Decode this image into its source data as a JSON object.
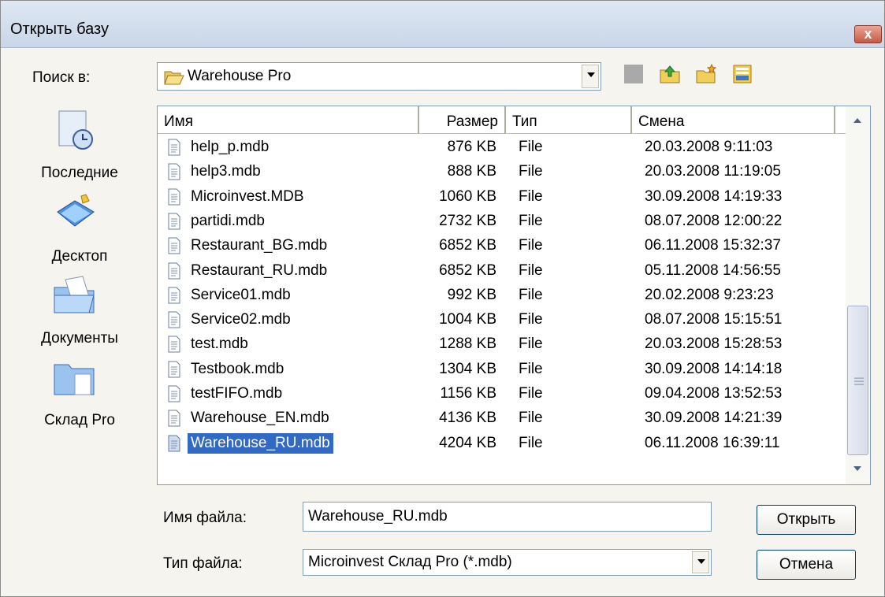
{
  "window": {
    "title": "Открыть базу",
    "close_label": "x"
  },
  "look_in": {
    "label": "Поиск в:",
    "value": "Warehouse Pro"
  },
  "toolbar": {
    "icons": [
      "back-icon",
      "up-folder-icon",
      "new-folder-icon",
      "view-menu-icon"
    ]
  },
  "places": [
    {
      "label": "Последние",
      "icon": "recent-icon"
    },
    {
      "label": "Десктоп",
      "icon": "desktop-icon"
    },
    {
      "label": "Документы",
      "icon": "documents-icon"
    },
    {
      "label": "Склад Pro",
      "icon": "folder-icon"
    }
  ],
  "columns": {
    "name": "Имя",
    "size": "Размер",
    "type": "Тип",
    "modified": "Смена"
  },
  "files": [
    {
      "name": "help_p.mdb",
      "size": "876 KB",
      "type": "File",
      "date": "20.03.2008 9:11:03"
    },
    {
      "name": "help3.mdb",
      "size": "888 KB",
      "type": "File",
      "date": "20.03.2008 11:19:05"
    },
    {
      "name": "Microinvest.MDB",
      "size": "1060 KB",
      "type": "File",
      "date": "30.09.2008 14:19:33"
    },
    {
      "name": "partidi.mdb",
      "size": "2732 KB",
      "type": "File",
      "date": "08.07.2008 12:00:22"
    },
    {
      "name": "Restaurant_BG.mdb",
      "size": "6852 KB",
      "type": "File",
      "date": "06.11.2008 15:32:37"
    },
    {
      "name": "Restaurant_RU.mdb",
      "size": "6852 KB",
      "type": "File",
      "date": "05.11.2008 14:56:55"
    },
    {
      "name": "Service01.mdb",
      "size": "992 KB",
      "type": "File",
      "date": "20.02.2008 9:23:23"
    },
    {
      "name": "Service02.mdb",
      "size": "1004 KB",
      "type": "File",
      "date": "08.07.2008 15:15:51"
    },
    {
      "name": "test.mdb",
      "size": "1288 KB",
      "type": "File",
      "date": "20.03.2008 15:28:53"
    },
    {
      "name": "Testbook.mdb",
      "size": "1304 KB",
      "type": "File",
      "date": "30.09.2008 14:14:18"
    },
    {
      "name": "testFIFO.mdb",
      "size": "1156 KB",
      "type": "File",
      "date": "09.04.2008 13:52:53"
    },
    {
      "name": "Warehouse_EN.mdb",
      "size": "4136 KB",
      "type": "File",
      "date": "30.09.2008 14:21:39"
    },
    {
      "name": "Warehouse_RU.mdb",
      "size": "4204 KB",
      "type": "File",
      "date": "06.11.2008 16:39:11",
      "selected": true
    }
  ],
  "filename": {
    "label": "Имя файла:",
    "value": "Warehouse_RU.mdb"
  },
  "filetype": {
    "label": "Тип файла:",
    "value": "Microinvest Склад Pro (*.mdb)"
  },
  "buttons": {
    "open": "Открыть",
    "cancel": "Отмена"
  },
  "colors": {
    "selection": "#316ac5",
    "title_bg": "#d3deec",
    "dialog_bg": "#f5f4ef"
  }
}
